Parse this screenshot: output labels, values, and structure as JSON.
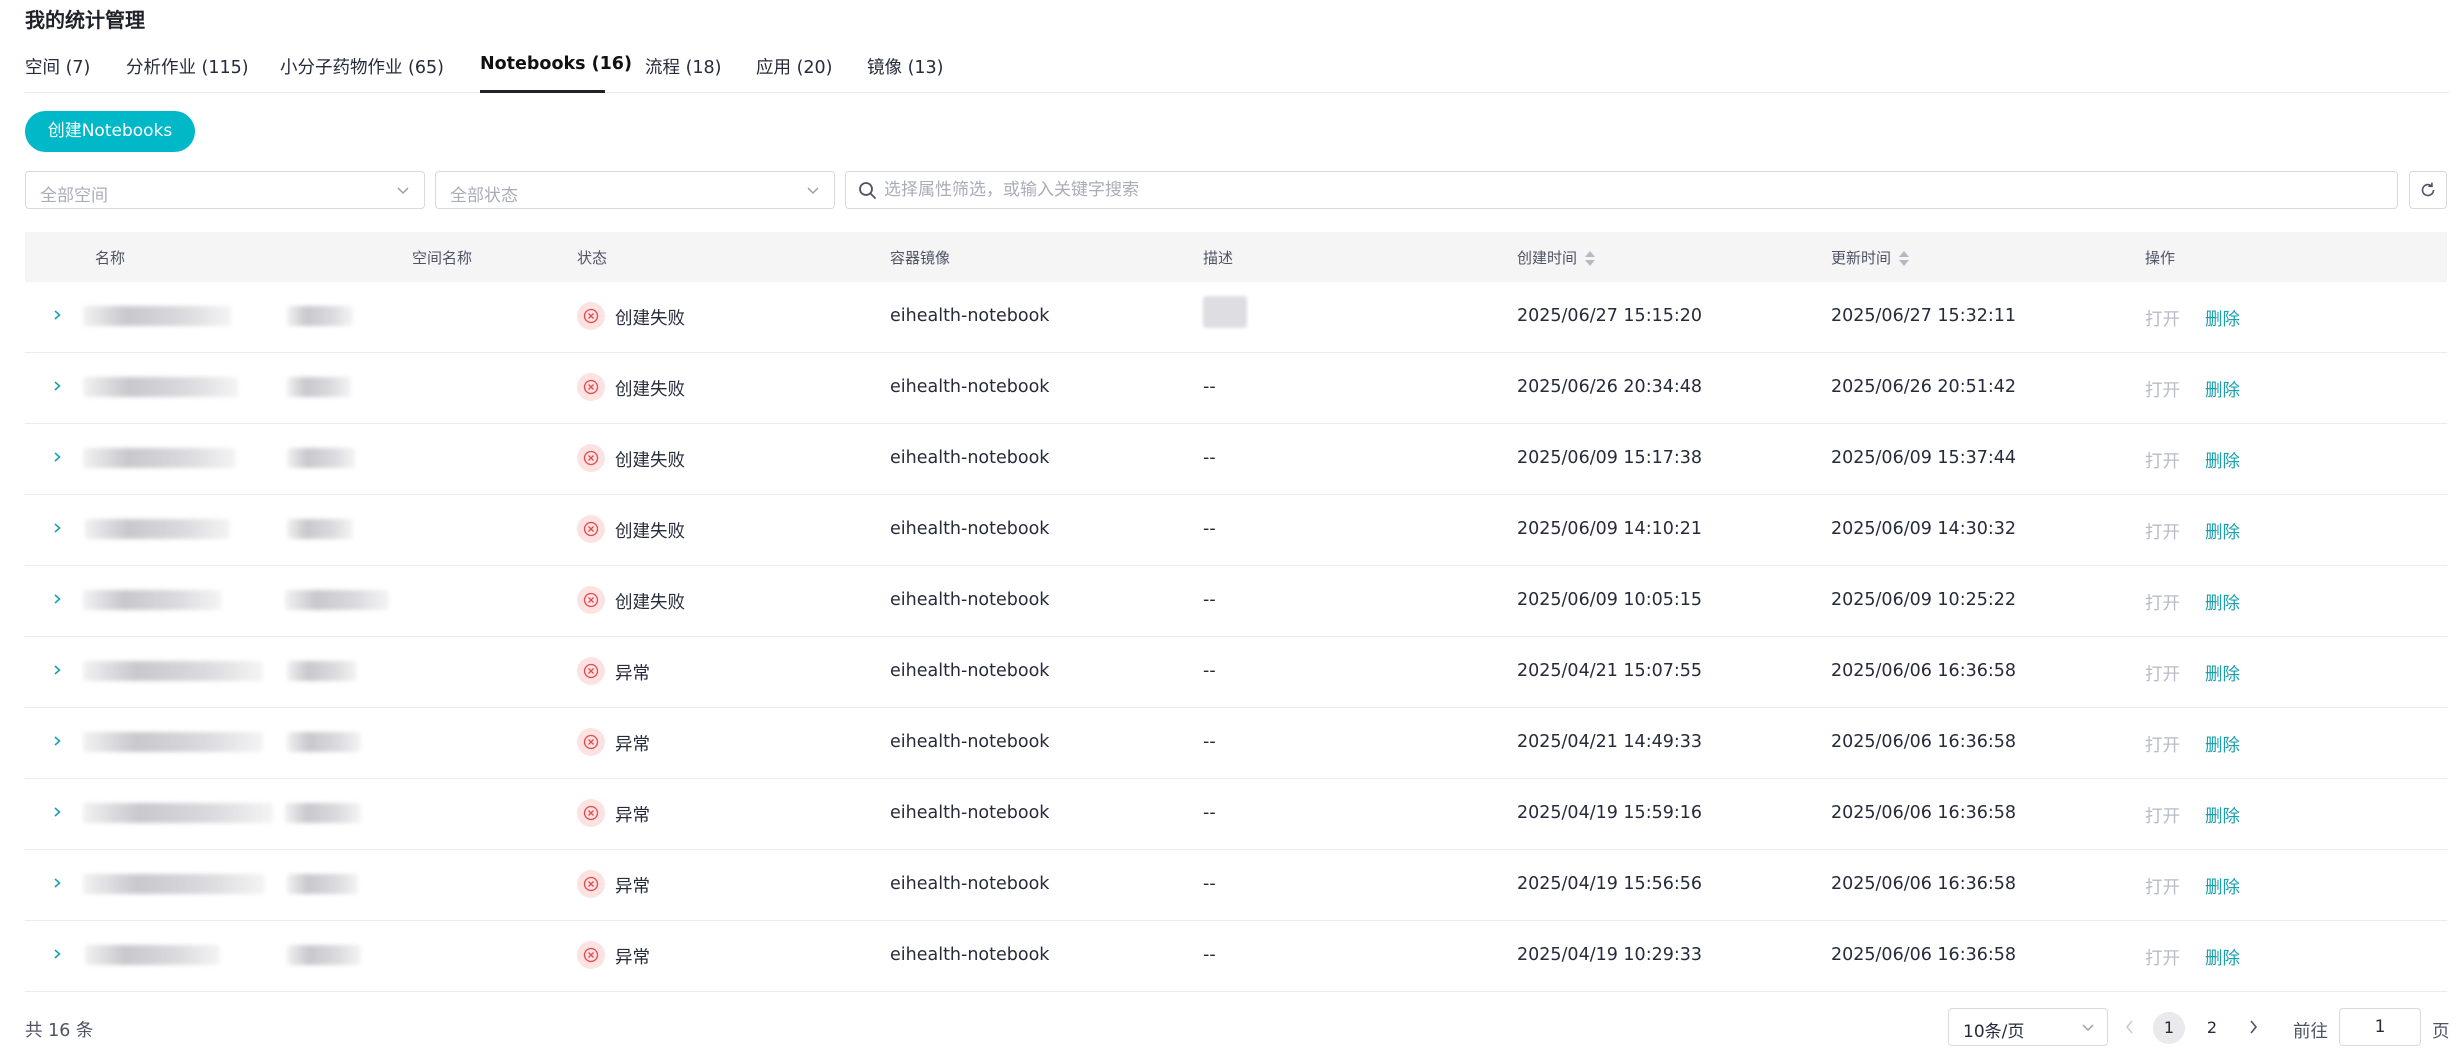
{
  "page": {
    "title": "我的统计管理"
  },
  "tabs": [
    {
      "label": "空间 (7)"
    },
    {
      "label": "分析作业 (115)"
    },
    {
      "label": "小分子药物作业 (65)"
    },
    {
      "label": "Notebooks (16)",
      "active": true
    },
    {
      "label": "流程 (18)"
    },
    {
      "label": "应用 (20)"
    },
    {
      "label": "镜像 (13)"
    }
  ],
  "toolbar": {
    "create_label": "创建Notebooks"
  },
  "filters": {
    "space_placeholder": "全部空间",
    "status_placeholder": "全部状态",
    "search_placeholder": "选择属性筛选，或输入关键字搜索"
  },
  "table": {
    "columns": {
      "name": "名称",
      "space": "空间名称",
      "status": "状态",
      "image": "容器镜像",
      "desc": "描述",
      "created": "创建时间",
      "updated": "更新时间",
      "actions": "操作"
    },
    "rows": [
      {
        "status": "创建失败",
        "image": "eihealth-notebook",
        "desc": "",
        "created": "2025/06/27 15:15:20",
        "updated": "2025/06/27 15:32:11",
        "open": "打开",
        "delete": "删除"
      },
      {
        "status": "创建失败",
        "image": "eihealth-notebook",
        "desc": "--",
        "created": "2025/06/26 20:34:48",
        "updated": "2025/06/26 20:51:42",
        "open": "打开",
        "delete": "删除"
      },
      {
        "status": "创建失败",
        "image": "eihealth-notebook",
        "desc": "--",
        "created": "2025/06/09 15:17:38",
        "updated": "2025/06/09 15:37:44",
        "open": "打开",
        "delete": "删除"
      },
      {
        "status": "创建失败",
        "image": "eihealth-notebook",
        "desc": "--",
        "created": "2025/06/09 14:10:21",
        "updated": "2025/06/09 14:30:32",
        "open": "打开",
        "delete": "删除"
      },
      {
        "status": "创建失败",
        "image": "eihealth-notebook",
        "desc": "--",
        "created": "2025/06/09 10:05:15",
        "updated": "2025/06/09 10:25:22",
        "open": "打开",
        "delete": "删除"
      },
      {
        "status": "异常",
        "image": "eihealth-notebook",
        "desc": "--",
        "created": "2025/04/21 15:07:55",
        "updated": "2025/06/06 16:36:58",
        "open": "打开",
        "delete": "删除"
      },
      {
        "status": "异常",
        "image": "eihealth-notebook",
        "desc": "--",
        "created": "2025/04/21 14:49:33",
        "updated": "2025/06/06 16:36:58",
        "open": "打开",
        "delete": "删除"
      },
      {
        "status": "异常",
        "image": "eihealth-notebook",
        "desc": "--",
        "created": "2025/04/19 15:59:16",
        "updated": "2025/06/06 16:36:58",
        "open": "打开",
        "delete": "删除"
      },
      {
        "status": "异常",
        "image": "eihealth-notebook",
        "desc": "--",
        "created": "2025/04/19 15:56:56",
        "updated": "2025/06/06 16:36:58",
        "open": "打开",
        "delete": "删除"
      },
      {
        "status": "异常",
        "image": "eihealth-notebook",
        "desc": "--",
        "created": "2025/04/19 10:29:33",
        "updated": "2025/06/06 16:36:58",
        "open": "打开",
        "delete": "删除"
      }
    ]
  },
  "pagination": {
    "total": "共 16 条",
    "page_size": "10条/页",
    "pages": [
      "1",
      "2"
    ],
    "current": "1",
    "goto_label": "前往",
    "goto_value": "1",
    "goto_unit": "页"
  },
  "icons": {
    "status": "error-circle-icon",
    "expand": "chevron-right-icon",
    "search": "search-icon",
    "refresh": "refresh-icon",
    "dropdown": "chevron-down-icon"
  },
  "colors": {
    "accent": "#00b8c7",
    "link": "#1aa0ad",
    "error": "#e5484d"
  }
}
